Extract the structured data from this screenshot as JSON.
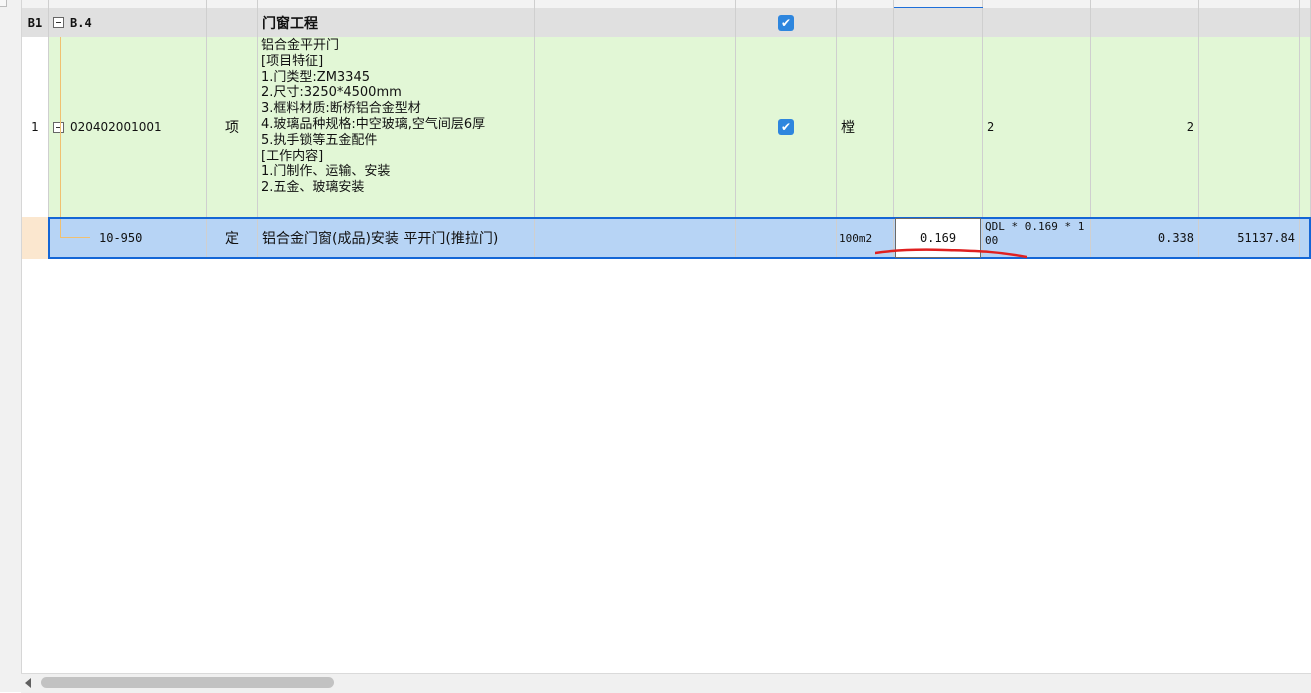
{
  "rows": {
    "b1": {
      "index": "B1",
      "code": "B.4",
      "name": "门窗工程",
      "checked": true
    },
    "item1": {
      "index": "1",
      "code": "020402001001",
      "category": "项",
      "description_lines": [
        "铝合金平开门",
        "[项目特征]",
        "1.门类型:ZM3345",
        "2.尺寸:3250*4500mm",
        "3.框料材质:断桥铝合金型材",
        "4.玻璃品种规格:中空玻璃,空气间层6厚",
        "5.执手锁等五金配件",
        "[工作内容]",
        "1.门制作、运输、安装",
        "2.五金、玻璃安装"
      ],
      "checked": true,
      "unit": "樘",
      "expression": "2",
      "quantity": "2"
    },
    "sub": {
      "code": "10-950",
      "category": "定",
      "name": "铝合金门窗(成品)安装 平开门(推拉门)",
      "unit": "100m2",
      "content_value": "0.169",
      "expression": "QDL * 0.169 * 100",
      "quantity": "0.338",
      "price": "51137.84"
    }
  },
  "colors": {
    "group_row": "#e0e0e0",
    "item_row": "#e2f7d6",
    "selected_row": "#b7d4f5",
    "selection_border": "#1466d6",
    "annotation_red": "#e02020"
  },
  "icons": {
    "collapse": "minus-box-icon",
    "check": "checkbox-checked-icon",
    "scroll_left": "left-arrow-icon"
  }
}
